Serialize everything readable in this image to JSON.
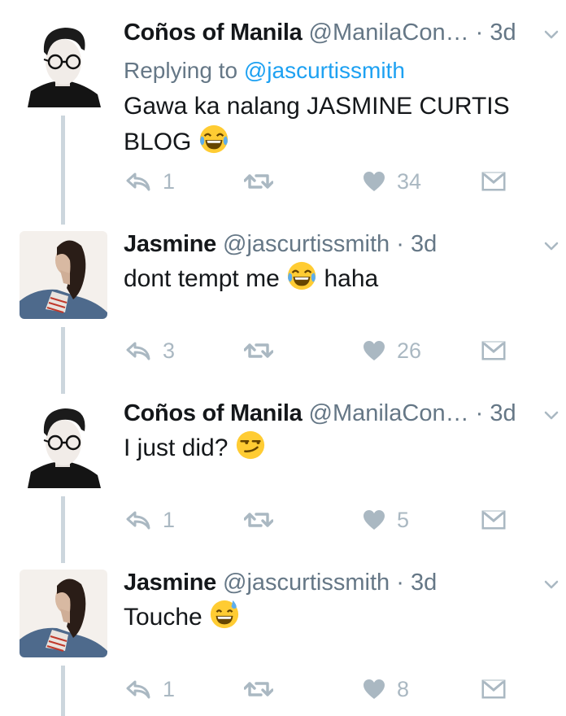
{
  "tweets": [
    {
      "name": "Coños of Manila",
      "handle": "@ManilaCon…",
      "separator": "·",
      "time": "3d",
      "replying_label": "Replying to",
      "replying_handle": "@jascurtissmith",
      "text": "Gawa ka nalang JASMINE CURTIS BLOG",
      "emoji": "face-with-tears-of-joy",
      "reply_count": "1",
      "retweet_count": "",
      "like_count": "34"
    },
    {
      "name": "Jasmine",
      "handle": "@jascurtissmith",
      "separator": "·",
      "time": "3d",
      "text_before": "dont tempt me",
      "text_after": "haha",
      "emoji": "face-with-tears-of-joy",
      "reply_count": "3",
      "retweet_count": "",
      "like_count": "26"
    },
    {
      "name": "Coños of Manila",
      "handle": "@ManilaCon…",
      "separator": "·",
      "time": "3d",
      "text": "I just did?",
      "emoji": "smirking-face",
      "reply_count": "1",
      "retweet_count": "",
      "like_count": "5"
    },
    {
      "name": "Jasmine",
      "handle": "@jascurtissmith",
      "separator": "·",
      "time": "3d",
      "text": "Touche",
      "emoji": "grinning-face-with-sweat",
      "reply_count": "1",
      "retweet_count": "",
      "like_count": "8"
    }
  ],
  "colors": {
    "accent": "#1da1f2",
    "muted": "#657786",
    "icon": "#aab8c2",
    "thread_line": "#ccd6dd"
  }
}
